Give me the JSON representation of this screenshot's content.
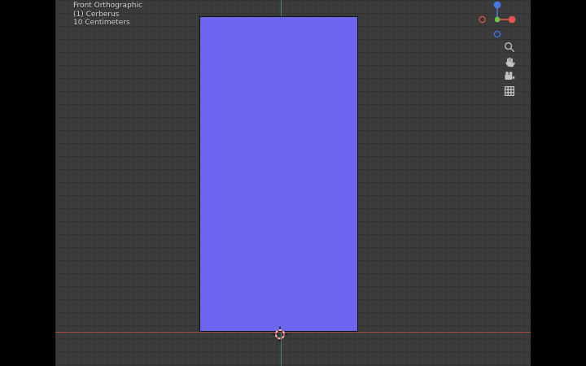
{
  "viewport": {
    "header": {
      "view_label": "Front Orthographic",
      "collection_label": "(1) Cerberus",
      "scale_label": "10 Centimeters"
    },
    "gizmo": {
      "axes": [
        {
          "name": "+X",
          "color": "#e2564f",
          "style": "filled"
        },
        {
          "name": "-X",
          "color": "#e2564f",
          "style": "hollow"
        },
        {
          "name": "+Y",
          "color": "#6fbf45",
          "style": "filled"
        },
        {
          "name": "+Z",
          "color": "#4a77e6",
          "style": "filled"
        },
        {
          "name": "-Z",
          "color": "#4a77e6",
          "style": "hollow"
        }
      ]
    },
    "nav_buttons": [
      {
        "icon": "magnifier-icon",
        "action": "zoom-view"
      },
      {
        "icon": "hand-icon",
        "action": "move-view"
      },
      {
        "icon": "camera-icon",
        "action": "camera-view"
      },
      {
        "icon": "grid-icon",
        "action": "toggle-orthographic"
      }
    ],
    "object": {
      "type": "plane",
      "fill": "#6c66ee"
    }
  },
  "colors": {
    "letterbox": "#000000",
    "background": "#3b3b3b",
    "grid_line": "#333333",
    "object_fill": "#6c66ee",
    "object_edge": "#141414",
    "x_axis_line": "#a3484d",
    "z_axis_line": "#47807c",
    "gizmo_x": "#e2564f",
    "gizmo_y": "#6fbf45",
    "gizmo_z": "#4a77e6",
    "icon": "#c3c3c3",
    "overlay_text": "#d6d6d6",
    "cursor_red": "#c8403f"
  }
}
